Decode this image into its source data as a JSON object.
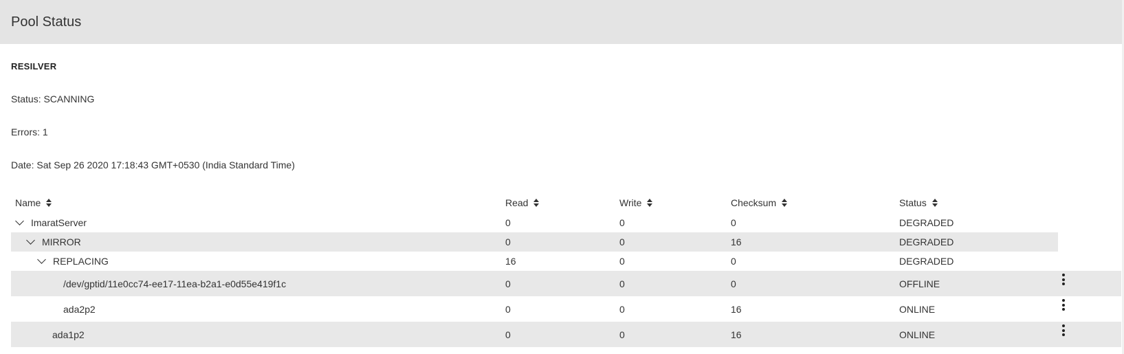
{
  "header": {
    "title": "Pool Status"
  },
  "scan": {
    "title": "RESILVER",
    "status": "Status: SCANNING",
    "errors": "Errors: 1",
    "date": "Date: Sat Sep 26 2020 17:18:43 GMT+0530 (India Standard Time)"
  },
  "table": {
    "columns": {
      "name": "Name",
      "read": "Read",
      "write": "Write",
      "checksum": "Checksum",
      "status": "Status"
    },
    "rows": [
      {
        "name": "ImaratServer",
        "read": "0",
        "write": "0",
        "checksum": "0",
        "status": "DEGRADED"
      },
      {
        "name": "MIRROR",
        "read": "0",
        "write": "0",
        "checksum": "16",
        "status": "DEGRADED"
      },
      {
        "name": "REPLACING",
        "read": "16",
        "write": "0",
        "checksum": "0",
        "status": "DEGRADED"
      },
      {
        "name": "/dev/gptid/11e0cc74-ee17-11ea-b2a1-e0d55e419f1c",
        "read": "0",
        "write": "0",
        "checksum": "0",
        "status": "OFFLINE"
      },
      {
        "name": "ada2p2",
        "read": "0",
        "write": "0",
        "checksum": "16",
        "status": "ONLINE"
      },
      {
        "name": "ada1p2",
        "read": "0",
        "write": "0",
        "checksum": "16",
        "status": "ONLINE"
      }
    ]
  },
  "icons": {
    "sort": "sort-icon",
    "expand": "chevron-down-icon",
    "menu": "more-vert-icon"
  }
}
